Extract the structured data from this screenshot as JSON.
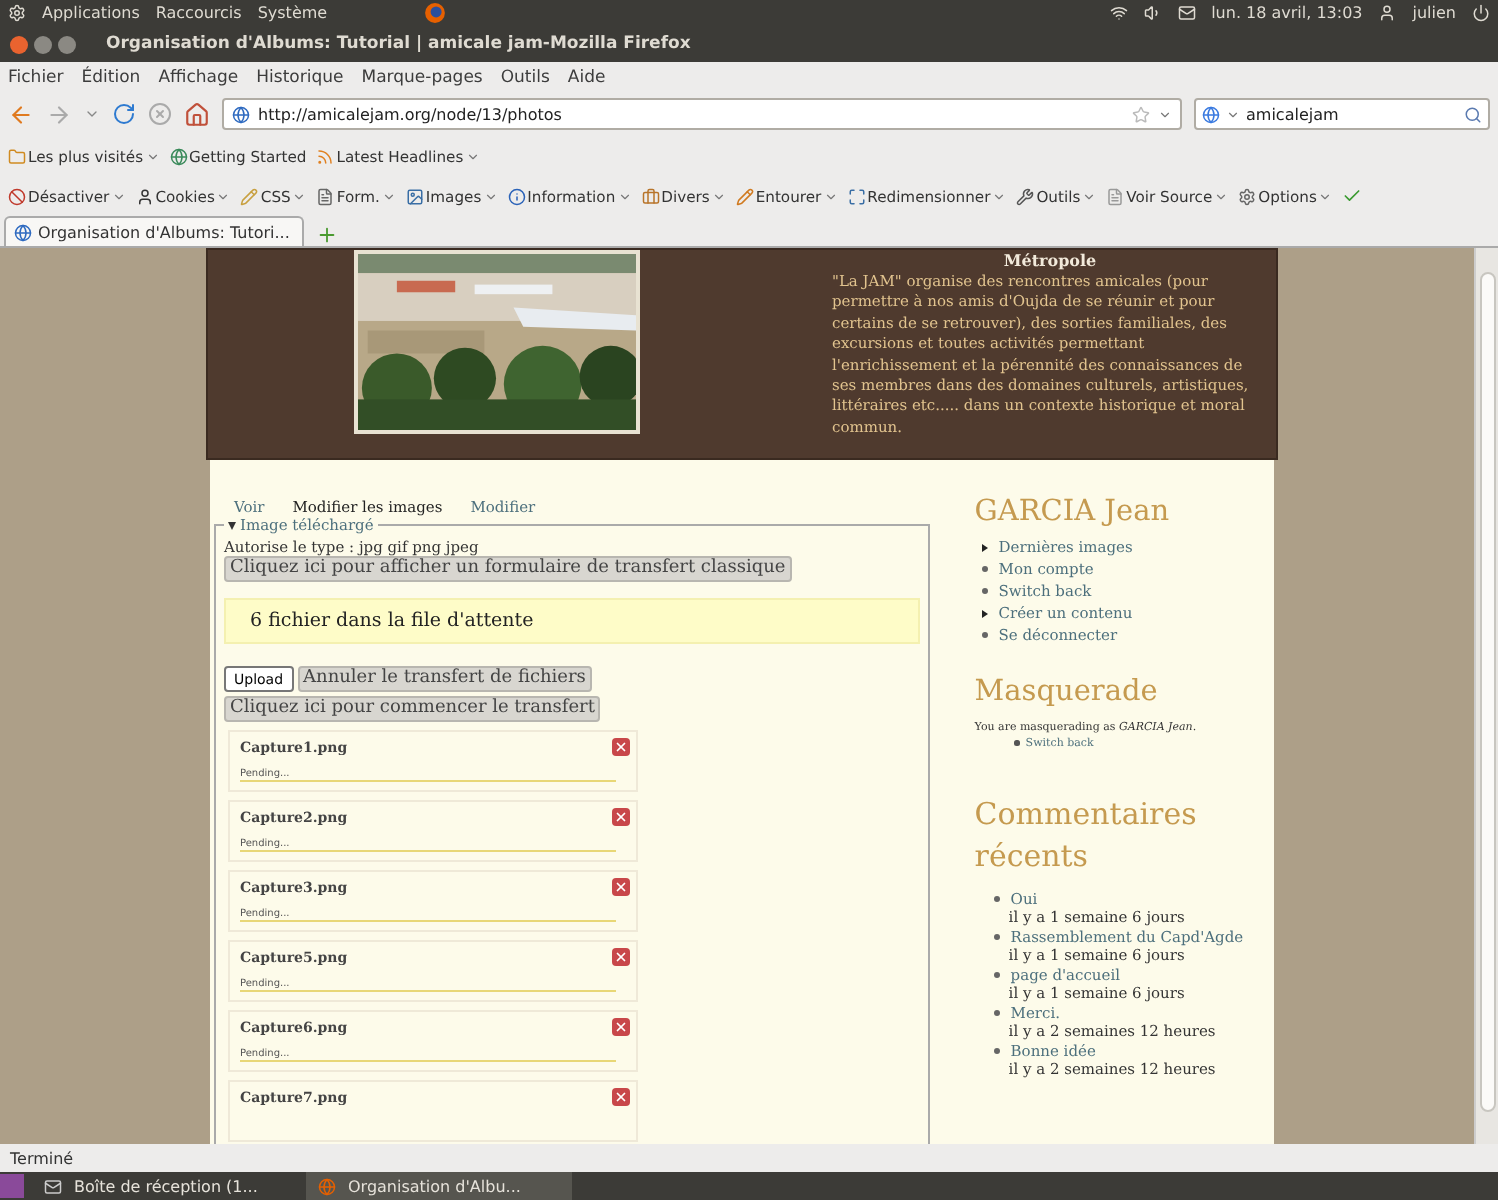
{
  "top_panel": {
    "menus": [
      "Applications",
      "Raccourcis",
      "Système"
    ],
    "clock": "lun. 18 avril, 13:03",
    "user": "julien"
  },
  "window": {
    "title": "Organisation d'Albums: Tutorial | amicale jam-Mozilla Firefox"
  },
  "menubar": [
    "Fichier",
    "Édition",
    "Affichage",
    "Historique",
    "Marque-pages",
    "Outils",
    "Aide"
  ],
  "nav": {
    "url": "http://amicalejam.org/node/13/photos",
    "search": "amicalejam"
  },
  "bookmarks": [
    {
      "label": "Les plus visités",
      "dropdown": true
    },
    {
      "label": "Getting Started",
      "dropdown": false
    },
    {
      "label": "Latest Headlines",
      "dropdown": true
    }
  ],
  "devtools": [
    "Désactiver",
    "Cookies",
    "CSS",
    "Form.",
    "Images",
    "Information",
    "Divers",
    "Entourer",
    "Redimensionner",
    "Outils",
    "Voir Source",
    "Options"
  ],
  "tabs": [
    {
      "label": "Organisation d'Albums: Tutori...",
      "selected": true
    }
  ],
  "header": {
    "title": "Métropole",
    "text": "\"La JAM\" organise des rencontres amicales (pour permettre à nos amis d'Oujda de se réunir et pour certains de se retrouver), des sorties familiales, des excursions et toutes activités permettant l'enrichissement et la pérennité des connaissances de ses membres dans des domaines culturels, artistiques, littéraires etc..... dans un contexte historique et moral commun."
  },
  "page_tabs": [
    {
      "label": "Voir",
      "selected": false
    },
    {
      "label": "Modifier les images",
      "selected": true
    },
    {
      "label": "Modifier",
      "selected": false
    }
  ],
  "upload": {
    "legend": "Image téléchargé",
    "allowed": "Autorise le type : jpg gif png jpeg",
    "classic_button": "Cliquez ici pour afficher un formulaire de transfert classique",
    "queue": "6 fichier dans la file d'attente",
    "upload_button": "Upload",
    "cancel_button": "Annuler le transfert de fichiers",
    "start_button": "Cliquez ici pour commencer le transfert",
    "files": [
      {
        "name": "Capture1.png",
        "status": "Pending..."
      },
      {
        "name": "Capture2.png",
        "status": "Pending..."
      },
      {
        "name": "Capture3.png",
        "status": "Pending..."
      },
      {
        "name": "Capture5.png",
        "status": "Pending..."
      },
      {
        "name": "Capture6.png",
        "status": "Pending..."
      },
      {
        "name": "Capture7.png"
      }
    ]
  },
  "sidebar": {
    "user_block": {
      "title": "GARCIA Jean",
      "links": [
        {
          "label": "Dernières images",
          "kind": "collapsed"
        },
        {
          "label": "Mon compte",
          "kind": "leaf"
        },
        {
          "label": "Switch back",
          "kind": "leaf"
        },
        {
          "label": "Créer un contenu",
          "kind": "collapsed"
        },
        {
          "label": "Se déconnecter",
          "kind": "leaf"
        }
      ]
    },
    "masquerade": {
      "title": "Masquerade",
      "text": "You are masquerading as *GARCIA Jean*.",
      "links": [
        "Switch back"
      ]
    },
    "comments": {
      "title": "Commentaires récents",
      "items": [
        {
          "link": "Oui",
          "time": "il y a 1 semaine 6 jours"
        },
        {
          "link": "Rassemblement du Capd'Agde",
          "time": "il y a 1 semaine 6 jours"
        },
        {
          "link": "page d'accueil",
          "time": "il y a 1 semaine 6 jours"
        },
        {
          "link": "Merci.",
          "time": "il y a 2 semaines 12 heures"
        },
        {
          "link": "Bonne idée",
          "time": "il y a 2 semaines 12 heures"
        }
      ]
    }
  },
  "status_bar": "Terminé",
  "taskbar": [
    {
      "label": "Boîte de réception (1...",
      "selected": false
    },
    {
      "label": "Organisation d'Albu...",
      "selected": true
    }
  ]
}
